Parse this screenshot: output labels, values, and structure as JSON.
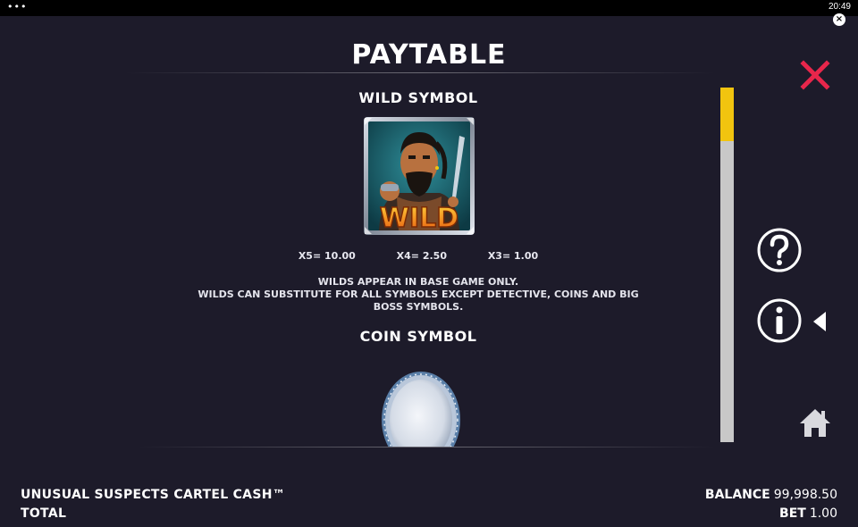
{
  "status_bar": {
    "dots": "•••",
    "time": "20:49",
    "close_glyph": "×"
  },
  "paytable": {
    "title": "PAYTABLE",
    "wild": {
      "title": "WILD SYMBOL",
      "symbol_text": "WILD",
      "payouts": [
        "X5= 10.00",
        "X4= 2.50",
        "X3= 1.00"
      ],
      "description": [
        "WILDS APPEAR IN BASE GAME ONLY.",
        "WILDS CAN SUBSTITUTE FOR ALL SYMBOLS EXCEPT DETECTIVE, COINS AND BIG",
        "BOSS SYMBOLS."
      ]
    },
    "coin": {
      "title": "COIN SYMBOL"
    },
    "scroll_progress": 0.0
  },
  "side_buttons": {
    "close_icon": "close-icon",
    "help_icon": "question-icon",
    "info_icon": "info-icon",
    "home_icon": "home-icon"
  },
  "footer": {
    "game_name": "UNUSUAL SUSPECTS CARTEL CASH™",
    "total_label": "TOTAL",
    "balance_label": "BALANCE",
    "balance_value": "99,998.50",
    "bet_label": "BET",
    "bet_value": "1.00"
  },
  "colors": {
    "background": "#1d1b2a",
    "accent_red": "#e8264b",
    "scroll_thumb": "#f1c40f",
    "scroll_track": "#c8c8c8"
  }
}
